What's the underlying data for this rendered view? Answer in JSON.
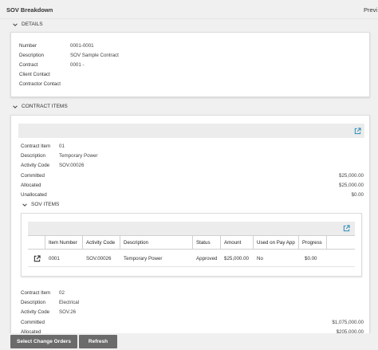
{
  "header": {
    "title": "SOV Breakdown",
    "preview_label": "Previ"
  },
  "details": {
    "section_label": "DETAILS",
    "fields": [
      {
        "label": "Number",
        "value": "0001-0001"
      },
      {
        "label": "Description",
        "value": "SOV Sample Contract"
      },
      {
        "label": "Contract",
        "value": "0001 -"
      },
      {
        "label": "Client Contact",
        "value": ""
      },
      {
        "label": "Contractor Contact",
        "value": ""
      }
    ]
  },
  "contract_items": {
    "section_label": "CONTRACT ITEMS",
    "items": [
      {
        "contract_item_label": "Contract Item",
        "contract_item": "01",
        "description_label": "Description",
        "description": "Temporary Power",
        "activity_code_label": "Activity Code",
        "activity_code": "SOV.00026",
        "committed_label": "Committed",
        "committed": "$25,000.00",
        "allocated_label": "Allocated",
        "allocated": "$25,000.00",
        "unallocated_label": "Unallocated",
        "unallocated": "$0.00"
      },
      {
        "contract_item_label": "Contract Item",
        "contract_item": "02",
        "description_label": "Description",
        "description": "Electrical",
        "activity_code_label": "Activity Code",
        "activity_code": "SOV.26",
        "committed_label": "Committed",
        "committed": "$1,075,000.00",
        "allocated_label": "Allocated",
        "allocated": "$205,000.00"
      }
    ],
    "sov_items": {
      "section_label": "SOV ITEMS",
      "columns": [
        "Item Number",
        "Activity Code",
        "Description",
        "Status",
        "Amount",
        "Used on Pay App",
        "Progress"
      ],
      "rows": [
        {
          "item_number": "0001",
          "activity_code": "SOV.00026",
          "description": "Temporary Power",
          "status": "Approved",
          "amount": "$25,000.00",
          "used_on_pay_app": "No",
          "progress": "$0.00"
        }
      ]
    }
  },
  "footer": {
    "select_change_orders": "Select Change Orders",
    "refresh": "Refresh"
  },
  "icons": {
    "collapse": "chevron-down-icon",
    "open_external": "open-external-icon",
    "edit": "edit-external-icon"
  },
  "colors": {
    "accent": "#2a8bb7",
    "button": "#6b6b6b"
  }
}
